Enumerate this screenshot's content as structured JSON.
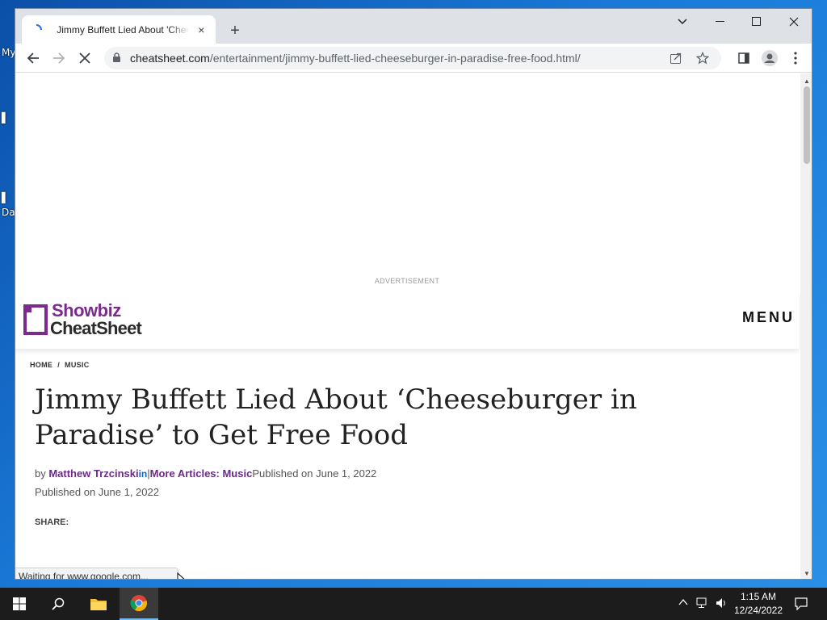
{
  "desktop": {
    "labels": [
      "My",
      "Da"
    ]
  },
  "browser": {
    "tab": {
      "title": "Jimmy Buffett Lied About 'Cheeseburger in Paradise' to Get Free Food",
      "close": "×"
    },
    "new_tab": "+",
    "address": {
      "host": "cheatsheet.com",
      "path": "/entertainment/jimmy-buffett-lied-cheeseburger-in-paradise-free-food.html/"
    },
    "status": "Waiting for www.google.com..."
  },
  "page": {
    "ad_label": "ADVERTISEMENT",
    "logo": {
      "line1": "Showbiz",
      "line2": "CheatSheet"
    },
    "menu_label": "MENU",
    "breadcrumb": {
      "home": "HOME",
      "separator": "/",
      "section": "MUSIC"
    },
    "headline": "Jimmy Buffett Lied About ‘Cheeseburger in Paradise’ to Get Free Food",
    "byline": {
      "by": "by ",
      "author": "Matthew Trzcinski",
      "linkedin": "in",
      "separator": "|",
      "more_articles": "More Articles: Music",
      "published": "Published on June 1, 2022"
    },
    "published_repeat": "Published on June 1, 2022",
    "share_label": "SHARE:"
  },
  "taskbar": {
    "time": "1:15 AM",
    "date": "12/24/2022"
  },
  "colors": {
    "brand_purple": "#7b2a8e",
    "linkedin_blue": "#0a66c2",
    "taskbar": "#1c1c1c"
  }
}
